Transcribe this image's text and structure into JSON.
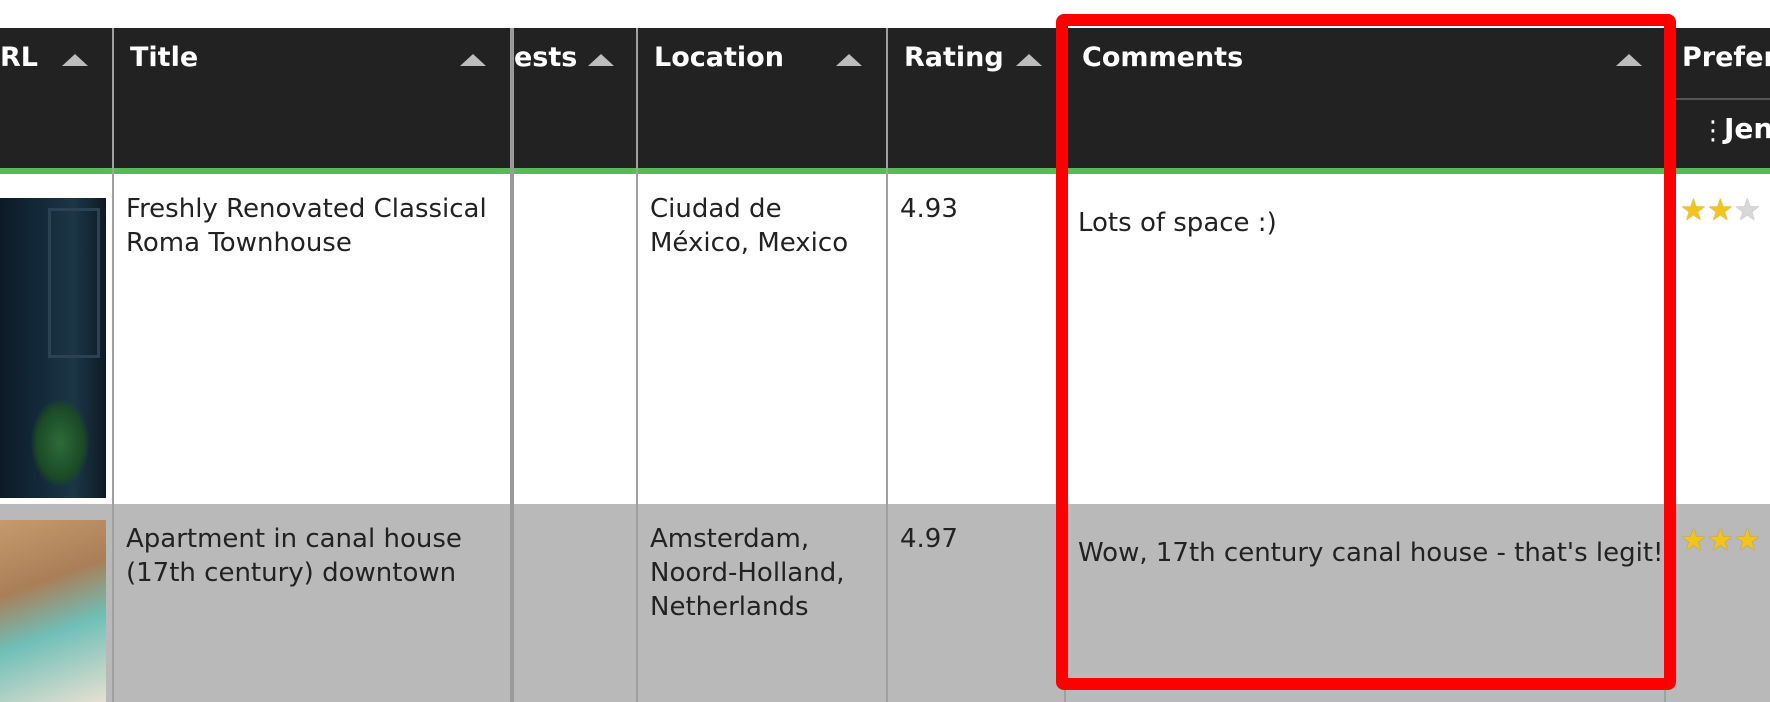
{
  "columns": {
    "url": "RL",
    "title": "Title",
    "guests": "ests",
    "location": "Location",
    "rating": "Rating",
    "comments": "Comments",
    "preference": "Prefer",
    "preference_sub": "Jen"
  },
  "rows": [
    {
      "image_icon": "listing-photo-interior",
      "title_line1": "Freshly Renovated Classical",
      "title_line2": "Roma Townhouse",
      "location_line1": "Ciudad de",
      "location_line2": "México, Mexico",
      "rating": "4.93",
      "comment": "Lots of space :)",
      "stars_filled": 2,
      "stars_shown": 3
    },
    {
      "image_icon": "listing-photo-canal-house",
      "title_line1": "Apartment in canal house",
      "title_line2": "(17th century) downtown",
      "location_line1": "Amsterdam,",
      "location_line2": "Noord-Holland,",
      "location_line3": "Netherlands",
      "rating": "4.97",
      "comment": "Wow, 17th century canal house - that's legit!",
      "stars_filled": 3,
      "stars_shown": 3
    }
  ],
  "colors": {
    "header_bg": "#222222",
    "header_divider": "#5cb85c",
    "row_alt_bg": "#b9b9b9",
    "highlight": "#ff0000",
    "star_filled": "#f3c419"
  }
}
